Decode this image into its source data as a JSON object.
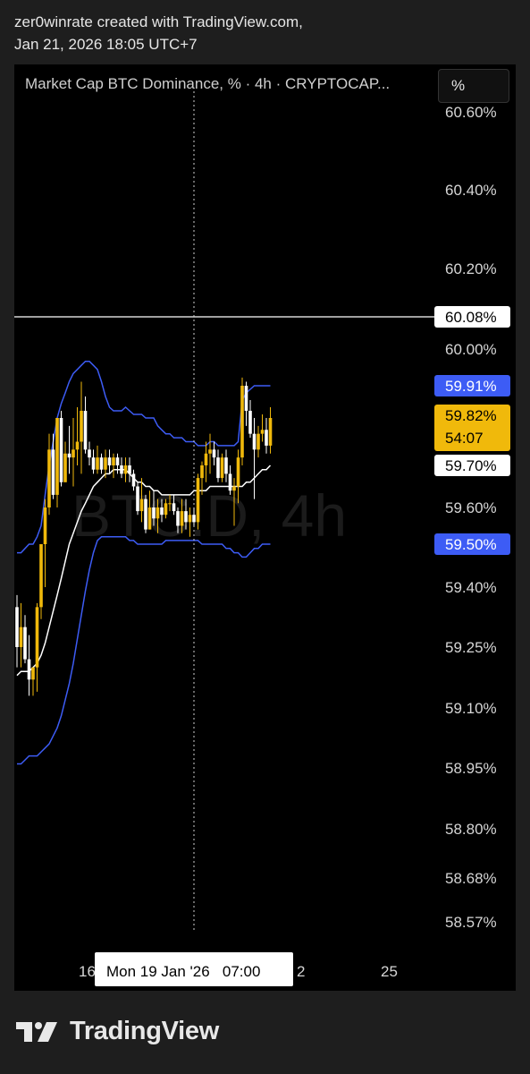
{
  "header": {
    "line1": "zer0winrate created with TradingView.com,",
    "line2": "Jan 21, 2026 18:05 UTC+7"
  },
  "chart_title": "Market Cap BTC Dominance, % · 4h · CRYPTOCAP...",
  "scale_button": "%",
  "watermark": "BTC.D, 4h",
  "footer_brand": "TradingView",
  "colors": {
    "bull": "#f0b90b",
    "bear": "#ffffff",
    "band": "#3d5cf5",
    "basis": "#ffffff",
    "background": "#000000"
  },
  "chart_data": {
    "type": "candlestick",
    "y_axis_labels": [
      "60.60%",
      "60.40%",
      "60.20%",
      "60.00%",
      "59.60%",
      "59.40%",
      "59.25%",
      "59.10%",
      "58.95%",
      "58.80%",
      "58.68%",
      "58.57%"
    ],
    "x_axis_labels": [
      "16",
      "2",
      "25"
    ],
    "crosshair_label": "Mon 19 Jan '26   07:00",
    "price_tags": [
      {
        "label": "60.08%",
        "style": "crosshair"
      },
      {
        "label": "59.91%",
        "style": "upper-band"
      },
      {
        "label": "59.82%",
        "sub": "54:07",
        "style": "last-price"
      },
      {
        "label": "59.70%",
        "style": "basis"
      },
      {
        "label": "59.50%",
        "style": "lower-band"
      }
    ],
    "horizontal_line": 60.08,
    "candles": [
      [
        59.35,
        59.38,
        59.2,
        59.25
      ],
      [
        59.25,
        59.36,
        59.2,
        59.3
      ],
      [
        59.3,
        59.33,
        59.21,
        59.22
      ],
      [
        59.22,
        59.28,
        59.13,
        59.17
      ],
      [
        59.17,
        59.2,
        59.13,
        59.2
      ],
      [
        59.2,
        59.36,
        59.14,
        59.35
      ],
      [
        59.35,
        59.5,
        59.32,
        59.5
      ],
      [
        59.5,
        59.62,
        59.4,
        59.6
      ],
      [
        59.6,
        59.78,
        59.58,
        59.74
      ],
      [
        59.74,
        59.78,
        59.62,
        59.63
      ],
      [
        59.63,
        59.82,
        59.6,
        59.82
      ],
      [
        59.82,
        59.84,
        59.65,
        59.66
      ],
      [
        59.66,
        59.76,
        59.66,
        59.73
      ],
      [
        59.73,
        59.8,
        59.68,
        59.72
      ],
      [
        59.72,
        59.82,
        59.65,
        59.74
      ],
      [
        59.74,
        59.85,
        59.7,
        59.76
      ],
      [
        59.76,
        59.92,
        59.68,
        59.84
      ],
      [
        59.84,
        59.88,
        59.73,
        59.74
      ],
      [
        59.74,
        59.76,
        59.7,
        59.72
      ],
      [
        59.72,
        59.74,
        59.68,
        59.69
      ],
      [
        59.69,
        59.75,
        59.68,
        59.72
      ],
      [
        59.72,
        59.73,
        59.68,
        59.69
      ],
      [
        59.69,
        59.74,
        59.67,
        59.72
      ],
      [
        59.72,
        59.74,
        59.68,
        59.7
      ],
      [
        59.7,
        59.73,
        59.67,
        59.72
      ],
      [
        59.72,
        59.73,
        59.68,
        59.7
      ],
      [
        59.7,
        59.72,
        59.67,
        59.68
      ],
      [
        59.68,
        59.72,
        59.66,
        59.7
      ],
      [
        59.7,
        59.72,
        59.66,
        59.68
      ],
      [
        59.68,
        59.69,
        59.64,
        59.65
      ],
      [
        59.65,
        59.66,
        59.58,
        59.59
      ],
      [
        59.59,
        59.67,
        59.56,
        59.62
      ],
      [
        59.62,
        59.63,
        59.53,
        59.54
      ],
      [
        59.54,
        59.64,
        59.54,
        59.6
      ],
      [
        59.6,
        59.64,
        59.55,
        59.57
      ],
      [
        59.57,
        59.62,
        59.53,
        59.6
      ],
      [
        59.6,
        59.62,
        59.56,
        59.58
      ],
      [
        59.58,
        59.62,
        59.57,
        59.61
      ],
      [
        59.61,
        59.63,
        59.59,
        59.61
      ],
      [
        59.61,
        59.63,
        59.58,
        59.59
      ],
      [
        59.59,
        59.6,
        59.53,
        59.55
      ],
      [
        59.55,
        59.62,
        59.53,
        59.59
      ],
      [
        59.59,
        59.62,
        59.54,
        59.56
      ],
      [
        59.56,
        59.6,
        59.52,
        59.58
      ],
      [
        59.58,
        59.6,
        59.55,
        59.56
      ],
      [
        59.56,
        59.68,
        59.54,
        59.67
      ],
      [
        59.67,
        59.71,
        59.63,
        59.7
      ],
      [
        59.7,
        59.76,
        59.66,
        59.73
      ],
      [
        59.73,
        59.78,
        59.68,
        59.74
      ],
      [
        59.74,
        59.76,
        59.7,
        59.72
      ],
      [
        59.72,
        59.74,
        59.66,
        59.67
      ],
      [
        59.67,
        59.73,
        59.66,
        59.72
      ],
      [
        59.72,
        59.74,
        59.66,
        59.68
      ],
      [
        59.68,
        59.7,
        59.63,
        59.64
      ],
      [
        59.64,
        59.67,
        59.55,
        59.65
      ],
      [
        59.65,
        59.74,
        59.61,
        59.72
      ],
      [
        59.72,
        59.93,
        59.7,
        59.91
      ],
      [
        59.91,
        59.92,
        59.8,
        59.84
      ],
      [
        59.84,
        59.87,
        59.77,
        59.78
      ],
      [
        59.78,
        59.82,
        59.62,
        59.74
      ],
      [
        59.74,
        59.8,
        59.72,
        59.78
      ],
      [
        59.78,
        59.83,
        59.76,
        59.79
      ],
      [
        59.79,
        59.82,
        59.73,
        59.75
      ],
      [
        59.75,
        59.85,
        59.73,
        59.82
      ]
    ],
    "bb_upper": [
      59.48,
      59.48,
      59.49,
      59.5,
      59.5,
      59.52,
      59.55,
      59.63,
      59.7,
      59.76,
      59.82,
      59.86,
      59.89,
      59.92,
      59.94,
      59.95,
      59.96,
      59.97,
      59.97,
      59.96,
      59.95,
      59.92,
      59.88,
      59.85,
      59.84,
      59.84,
      59.84,
      59.85,
      59.84,
      59.83,
      59.83,
      59.83,
      59.82,
      59.82,
      59.82,
      59.8,
      59.79,
      59.78,
      59.78,
      59.77,
      59.77,
      59.77,
      59.76,
      59.76,
      59.76,
      59.75,
      59.75,
      59.75,
      59.76,
      59.76,
      59.75,
      59.75,
      59.75,
      59.75,
      59.75,
      59.76,
      59.87,
      59.89,
      59.9,
      59.91,
      59.91,
      59.91,
      59.91,
      59.91
    ],
    "bb_lower": [
      58.96,
      58.96,
      58.97,
      58.98,
      58.98,
      58.98,
      58.99,
      59.0,
      59.01,
      59.03,
      59.05,
      59.08,
      59.12,
      59.16,
      59.21,
      59.27,
      59.33,
      59.39,
      59.44,
      59.48,
      59.51,
      59.52,
      59.52,
      59.52,
      59.52,
      59.52,
      59.52,
      59.52,
      59.51,
      59.51,
      59.5,
      59.5,
      59.5,
      59.5,
      59.5,
      59.5,
      59.5,
      59.51,
      59.51,
      59.51,
      59.51,
      59.51,
      59.51,
      59.51,
      59.51,
      59.51,
      59.5,
      59.5,
      59.5,
      59.5,
      59.5,
      59.5,
      59.49,
      59.49,
      59.48,
      59.48,
      59.47,
      59.47,
      59.48,
      59.49,
      59.49,
      59.5,
      59.5,
      59.5
    ],
    "bb_basis": [
      59.18,
      59.19,
      59.19,
      59.19,
      59.2,
      59.21,
      59.23,
      59.26,
      59.3,
      59.34,
      59.38,
      59.42,
      59.46,
      59.5,
      59.53,
      59.56,
      59.59,
      59.61,
      59.63,
      59.65,
      59.66,
      59.67,
      59.68,
      59.68,
      59.69,
      59.69,
      59.69,
      59.69,
      59.68,
      59.67,
      59.66,
      59.66,
      59.65,
      59.65,
      59.64,
      59.64,
      59.63,
      59.63,
      59.63,
      59.63,
      59.63,
      59.63,
      59.63,
      59.63,
      59.64,
      59.64,
      59.64,
      59.64,
      59.65,
      59.65,
      59.65,
      59.65,
      59.65,
      59.65,
      59.65,
      59.65,
      59.65,
      59.66,
      59.66,
      59.67,
      59.68,
      59.69,
      59.69,
      59.7
    ]
  }
}
